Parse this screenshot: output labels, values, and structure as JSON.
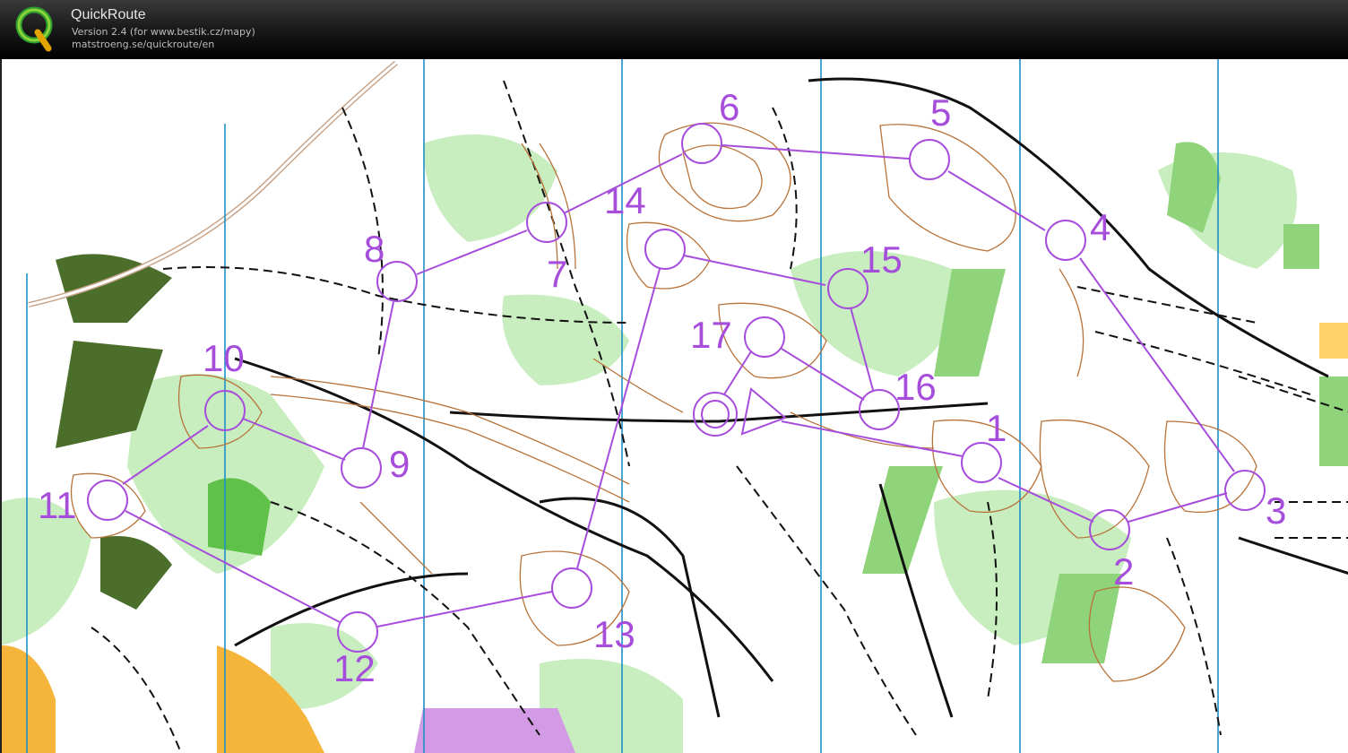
{
  "app": {
    "title": "QuickRoute",
    "version": "Version 2.4  (for www.bestik.cz/mapy)",
    "url": "matstroeng.se/quickroute/en",
    "logo_icon": "quickroute-q-logo"
  },
  "colors": {
    "course": "#a64ddb",
    "open_land": "#ffc23d",
    "forest_green": "#8fd37a",
    "light_green": "#c8eec0",
    "contour": "#b8733a",
    "meridian": "#1e90c8",
    "urban": "#4b6e2a"
  },
  "course": {
    "start_icon": "start-triangle",
    "finish_icon": "finish-double-circle",
    "controls": [
      {
        "number": "1"
      },
      {
        "number": "2"
      },
      {
        "number": "3"
      },
      {
        "number": "4"
      },
      {
        "number": "5"
      },
      {
        "number": "6"
      },
      {
        "number": "7"
      },
      {
        "number": "8"
      },
      {
        "number": "9"
      },
      {
        "number": "10"
      },
      {
        "number": "11"
      },
      {
        "number": "12"
      },
      {
        "number": "13"
      },
      {
        "number": "14"
      },
      {
        "number": "15"
      },
      {
        "number": "16"
      },
      {
        "number": "17"
      }
    ]
  }
}
